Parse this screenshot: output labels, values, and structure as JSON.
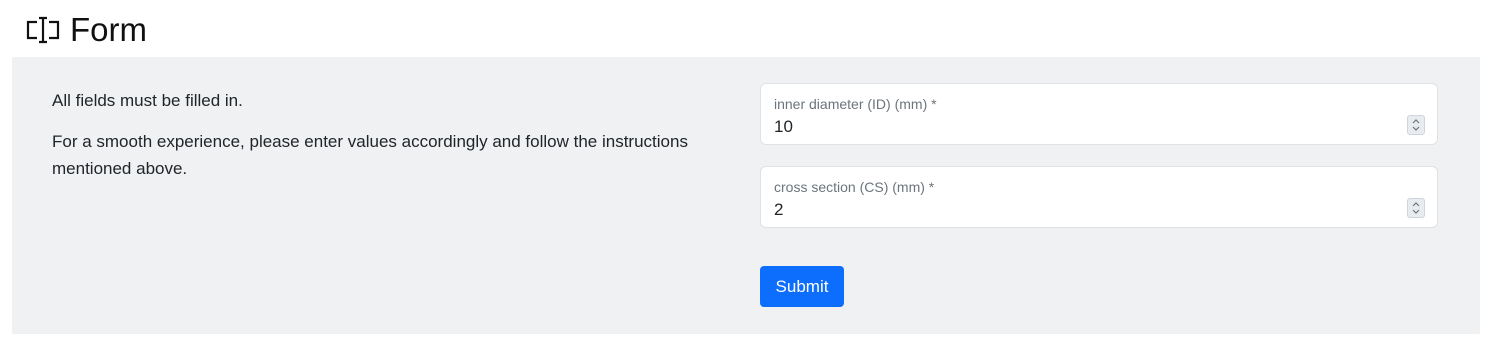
{
  "header": {
    "title": "Form",
    "icon": "form-textbox-icon"
  },
  "instructions": {
    "line1": "All fields must be filled in.",
    "line2": "For a smooth experience, please enter values accordingly and follow the instructions mentioned above."
  },
  "fields": [
    {
      "label": "inner diameter (ID) (mm) *",
      "value": "10"
    },
    {
      "label": "cross section (CS) (mm) *",
      "value": "2"
    }
  ],
  "submit": {
    "label": "Submit",
    "color": "#0d6efd"
  },
  "colors": {
    "panel_bg": "#eff1f3",
    "label_text": "#6c757d"
  }
}
